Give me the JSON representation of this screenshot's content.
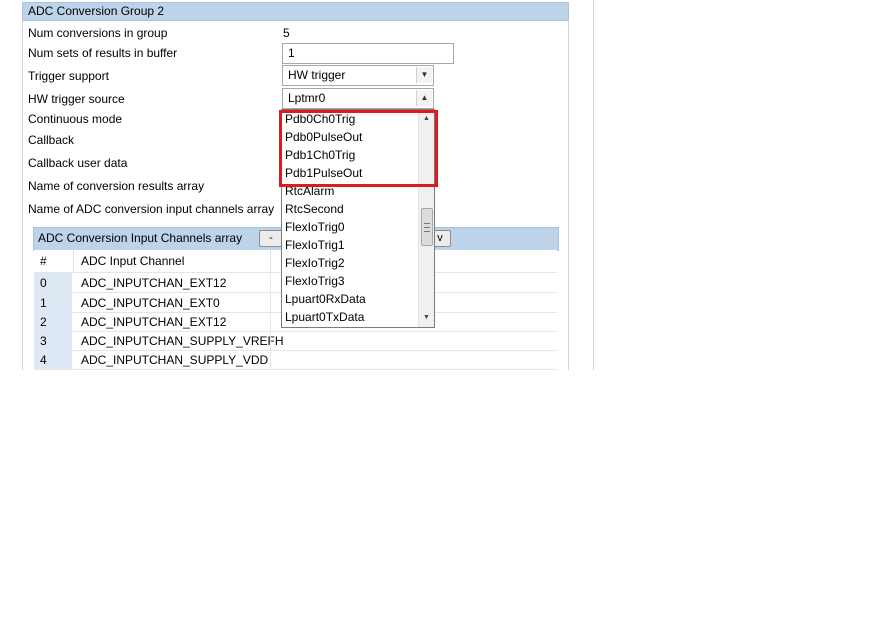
{
  "group": {
    "title": "ADC Conversion Group 2"
  },
  "fields": {
    "num_conversions_label": "Num conversions in group",
    "num_conversions_value": "5",
    "num_sets_label": "Num sets of results in buffer",
    "num_sets_value": "1",
    "trigger_support_label": "Trigger support",
    "trigger_support_value": "HW trigger",
    "hw_trigger_source_label": "HW trigger source",
    "hw_trigger_source_value": "Lptmr0",
    "continuous_mode_label": "Continuous mode",
    "callback_label": "Callback",
    "callback_user_data_label": "Callback user data",
    "results_array_label": "Name of conversion results array",
    "input_channels_array_label": "Name of ADC conversion input channels array"
  },
  "dropdown": {
    "items": [
      "Pdb0Ch0Trig",
      "Pdb0PulseOut",
      "Pdb1Ch0Trig",
      "Pdb1PulseOut",
      "RtcAlarm",
      "RtcSecond",
      "FlexIoTrig0",
      "FlexIoTrig1",
      "FlexIoTrig2",
      "FlexIoTrig3",
      "Lpuart0RxData",
      "Lpuart0TxData"
    ],
    "scroll_position": 0.55
  },
  "channels_table": {
    "title": "ADC Conversion Input Channels array",
    "remove_button": "-",
    "more_button": "v",
    "columns": [
      "#",
      "ADC Input Channel"
    ],
    "rows": [
      {
        "index": "0",
        "channel": "ADC_INPUTCHAN_EXT12"
      },
      {
        "index": "1",
        "channel": "ADC_INPUTCHAN_EXT0"
      },
      {
        "index": "2",
        "channel": "ADC_INPUTCHAN_EXT12"
      },
      {
        "index": "3",
        "channel": "ADC_INPUTCHAN_SUPPLY_VREFH"
      },
      {
        "index": "4",
        "channel": "ADC_INPUTCHAN_SUPPLY_VDD"
      }
    ]
  },
  "colors": {
    "header_bg": "#bcd3ea",
    "highlight": "#e0181f",
    "index_cell": "#dde8f4"
  }
}
